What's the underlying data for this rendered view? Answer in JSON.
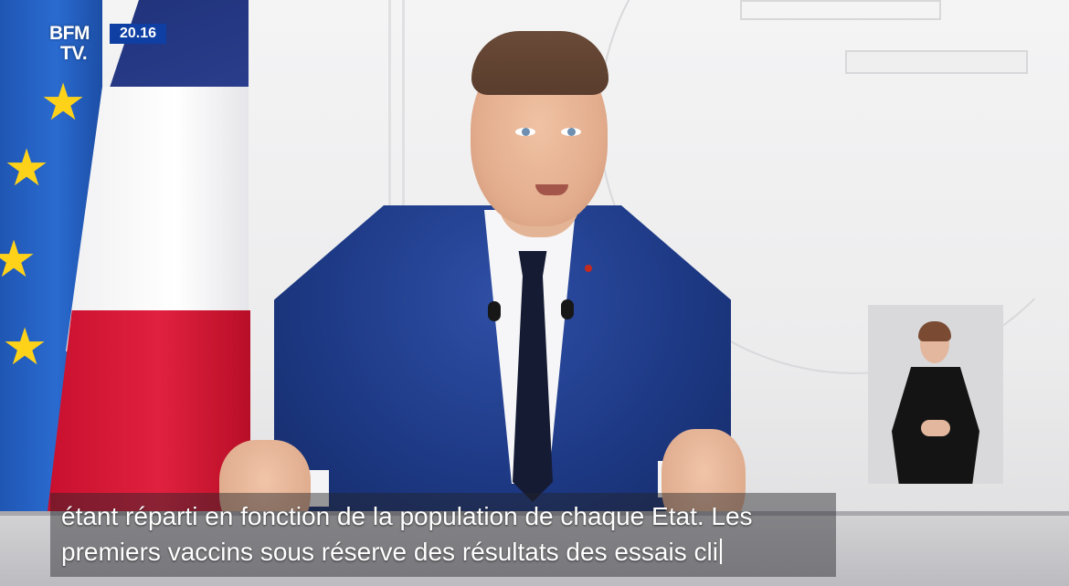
{
  "broadcast": {
    "channel_logo_line1": "BFM",
    "channel_logo_line2": "TV.",
    "clock": "20.16"
  },
  "colors": {
    "logo_badge": "#0f3fa3",
    "eu_blue": "#2a6bd0",
    "eu_star": "#ffd21a",
    "fr_blue": "#2b3f8f",
    "fr_red": "#e0213f",
    "suit": "#1e3a86"
  },
  "subtitles": {
    "line1": "étant réparti en fonction de la population de chaque Etat. Les",
    "line2": "premiers vaccins sous réserve des résultats des essais cli"
  },
  "inset": {
    "type": "sign-language-interpreter"
  }
}
